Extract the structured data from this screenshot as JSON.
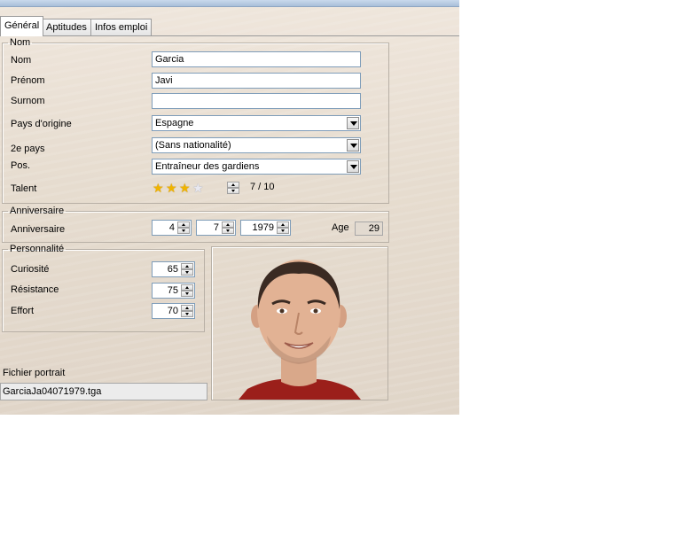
{
  "tabs": [
    {
      "label": "Général",
      "active": true
    },
    {
      "label": "Aptitudes",
      "active": false
    },
    {
      "label": "Infos emploi",
      "active": false
    }
  ],
  "nom_group": {
    "legend": "Nom",
    "nom_label": "Nom",
    "nom_value": "Garcia",
    "prenom_label": "Prénom",
    "prenom_value": "Javi",
    "surnom_label": "Surnom",
    "surnom_value": "",
    "pays_label": "Pays d'origine",
    "pays_value": "Espagne",
    "pays2_label": "2e pays",
    "pays2_value": "(Sans nationalité)",
    "pos_label": "Pos.",
    "pos_value": "Entraîneur des gardiens",
    "talent_label": "Talent",
    "talent_value": "7 / 10",
    "talent_stars_filled": 3,
    "talent_stars_total": 4
  },
  "anniversaire_group": {
    "legend": "Anniversaire",
    "label": "Anniversaire",
    "day": "4",
    "month": "7",
    "year": "1979",
    "age_label": "Age",
    "age_value": "29"
  },
  "personnalite_group": {
    "legend": "Personnalité",
    "curiosite_label": "Curiosité",
    "curiosite_value": "65",
    "resistance_label": "Résistance",
    "resistance_value": "75",
    "effort_label": "Effort",
    "effort_value": "70"
  },
  "portrait_file": {
    "label": "Fichier portrait",
    "value": "GarciaJa04071979.tga"
  },
  "colors": {
    "panel": "#e6dccf",
    "star_on": "#f0b400",
    "input_border": "#7f9db9"
  }
}
